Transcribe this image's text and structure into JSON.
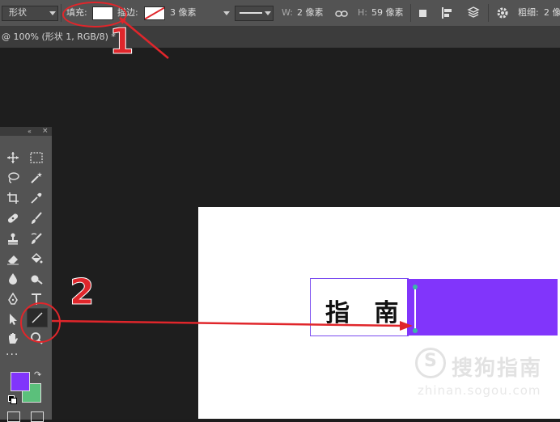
{
  "options_bar": {
    "mode_value": "形状",
    "fill_label": "填充:",
    "stroke_label": "描边:",
    "stroke_width_value": "3 像素",
    "width_label": "W:",
    "width_value": "2 像素",
    "height_label": "H:",
    "height_value": "59 像素",
    "weight_label": "粗细:",
    "weight_value": "2 像素"
  },
  "document_tab": {
    "title": "@ 100% (形状 1, RGB/8) *"
  },
  "canvas": {
    "text": "指 南",
    "shape_color": "#8135fb"
  },
  "watermark": {
    "brand": "搜狗指南",
    "url": "zhinan.sogou.com"
  },
  "annotations": {
    "marker_1": "1",
    "marker_2": "2",
    "annotation_color": "#e0262b"
  },
  "toolbar": {
    "foreground_color": "#8135fb",
    "background_color": "#5bc07b",
    "more_label": "..."
  }
}
